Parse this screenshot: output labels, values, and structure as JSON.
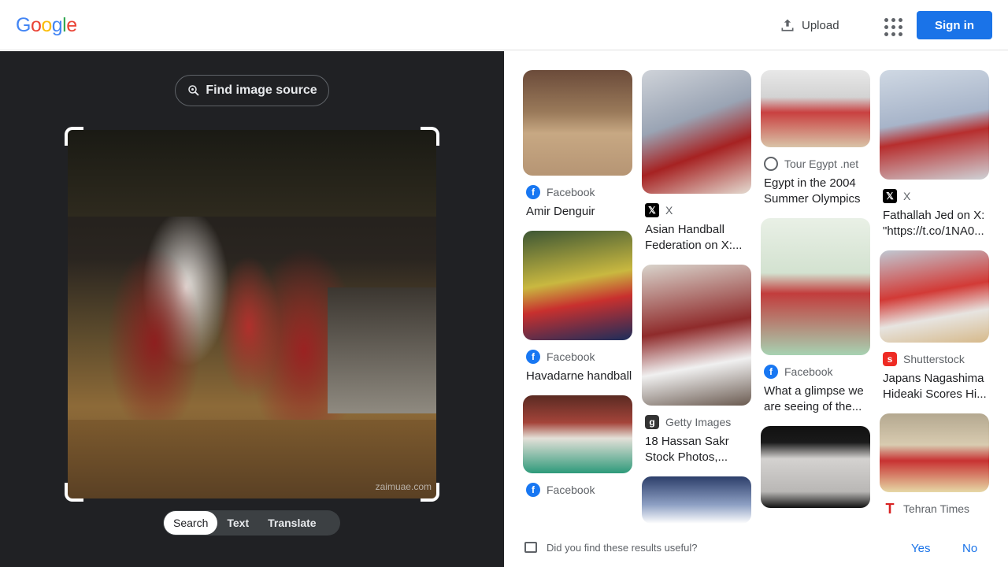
{
  "header": {
    "logo_letters": [
      {
        "ch": "G",
        "color": "#4285f4"
      },
      {
        "ch": "o",
        "color": "#ea4335"
      },
      {
        "ch": "o",
        "color": "#fbbc05"
      },
      {
        "ch": "g",
        "color": "#4285f4"
      },
      {
        "ch": "l",
        "color": "#34a853"
      },
      {
        "ch": "e",
        "color": "#ea4335"
      }
    ],
    "upload_label": "Upload",
    "upload_icon": "upload-icon",
    "apps_icon": "apps-grid-icon",
    "signin_label": "Sign in"
  },
  "left_panel": {
    "find_source_label": "Find image source",
    "find_source_icon": "lens-search-icon",
    "image_watermark": "zaimuae.com",
    "modes": [
      {
        "label": "Search",
        "active": true
      },
      {
        "label": "Text",
        "active": false
      },
      {
        "label": "Translate",
        "active": false
      }
    ]
  },
  "results": {
    "columns": [
      [
        {
          "source": "Facebook",
          "favicon": "facebook-icon",
          "title": "Amir Denguir",
          "thumb": "t-gym"
        },
        {
          "source": "Facebook",
          "favicon": "facebook-icon",
          "title": "Havadarne handball",
          "thumb": "t-yellow"
        },
        {
          "source": "Facebook",
          "favicon": "facebook-icon",
          "title": "",
          "thumb": "t-stadium"
        }
      ],
      [
        {
          "source": "X",
          "favicon": "x-icon",
          "title": "Asian Handball Federation on X:...",
          "thumb": "t-red"
        },
        {
          "source": "Getty Images",
          "favicon": "getty-icon",
          "title": "18 Hassan Sakr Stock Photos,...",
          "thumb": "t-hall"
        },
        {
          "source": "",
          "favicon": "",
          "title": "",
          "thumb": "t-blue2"
        }
      ],
      [
        {
          "source": "Tour Egypt .net",
          "favicon": "globe-icon",
          "title": "Egypt in the 2004 Summer Olympics",
          "thumb": "t-court"
        },
        {
          "source": "Facebook",
          "favicon": "facebook-icon",
          "title": "What a glimpse we are seeing of the...",
          "thumb": "t-green"
        },
        {
          "source": "",
          "favicon": "",
          "title": "",
          "thumb": "t-dark"
        }
      ],
      [
        {
          "source": "X",
          "favicon": "x-icon",
          "title": "Fathallah Jed on X: \"https://t.co/1NA0...",
          "thumb": "t-blue"
        },
        {
          "source": "Shutterstock",
          "favicon": "shutterstock-icon",
          "title": "Japans Nagashima Hideaki Scores Hi...",
          "thumb": "t-jump"
        },
        {
          "source": "Tehran Times",
          "favicon": "tehran-times-icon",
          "title": "",
          "thumb": "t-floor"
        }
      ]
    ]
  },
  "feedback": {
    "question": "Did you find these results useful?",
    "yes_label": "Yes",
    "no_label": "No"
  }
}
